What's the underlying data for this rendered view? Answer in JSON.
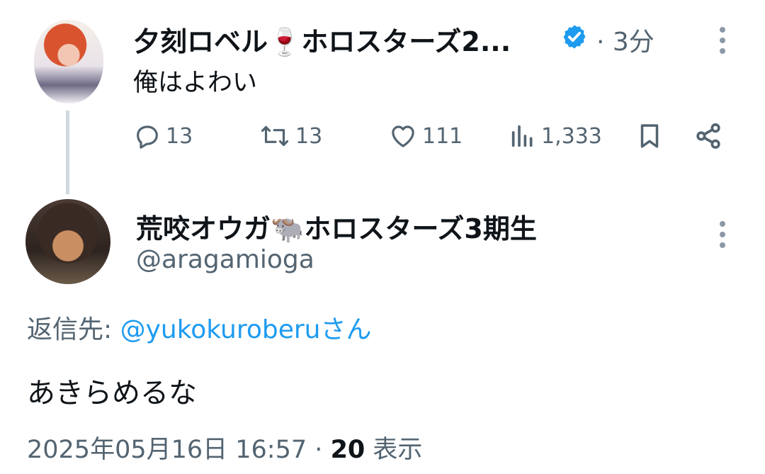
{
  "parent_tweet": {
    "display_name": "夕刻ロベル🍷ホロスターズ2...",
    "verified": true,
    "separator": "·",
    "time": "3分",
    "text": "俺はよわい",
    "actions": {
      "replies": "13",
      "reposts": "13",
      "likes": "111",
      "views": "1,333"
    }
  },
  "reply_tweet": {
    "display_name": "荒咬オウガ🐃ホロスターズ3期生",
    "handle": "@aragamioga",
    "reply_to_prefix": "返信先: ",
    "reply_to_user": "@yukokuroberuさん",
    "text": "あきらめるな",
    "timestamp": "2025年05月16日 16:57",
    "separator": "·",
    "views_count": "20",
    "views_label": "表示"
  },
  "colors": {
    "text_primary": "#0f1419",
    "text_secondary": "#536471",
    "link": "#1d9bf0",
    "verified_badge": "#1d9bf0",
    "thread_line": "#cfd9de"
  }
}
